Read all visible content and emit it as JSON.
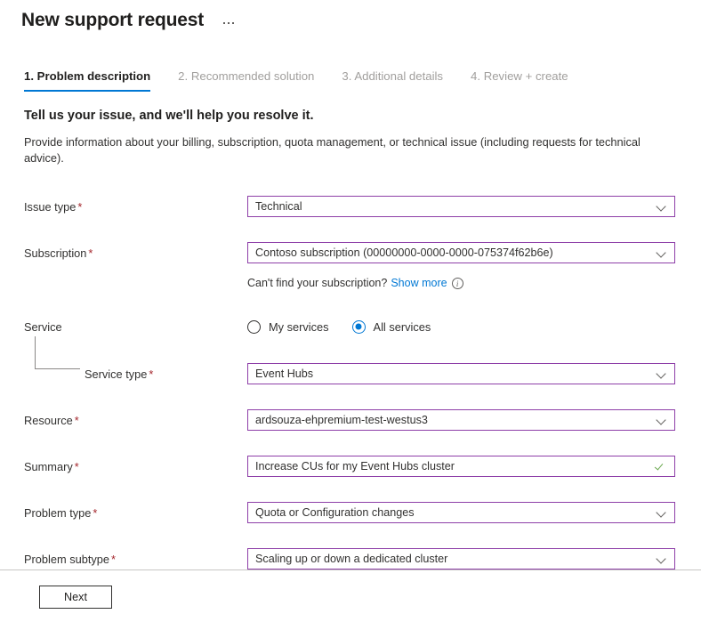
{
  "header": {
    "title": "New support request",
    "more_menu": "ellipsis-menu"
  },
  "tabs": [
    {
      "label": "1. Problem description",
      "active": true
    },
    {
      "label": "2. Recommended solution",
      "active": false
    },
    {
      "label": "3. Additional details",
      "active": false
    },
    {
      "label": "4. Review + create",
      "active": false
    }
  ],
  "intro": {
    "heading": "Tell us your issue, and we'll help you resolve it.",
    "text": "Provide information about your billing, subscription, quota management, or technical issue (including requests for technical advice)."
  },
  "form": {
    "issue_type": {
      "label": "Issue type",
      "required": "*",
      "value": "Technical"
    },
    "subscription": {
      "label": "Subscription",
      "required": "*",
      "value": "Contoso subscription (00000000-0000-0000-075374f62b6e)"
    },
    "subscription_helper": {
      "text": "Can't find your subscription?",
      "link": "Show more",
      "info": "i"
    },
    "service": {
      "label": "Service",
      "options": [
        {
          "label": "My services",
          "selected": false
        },
        {
          "label": "All services",
          "selected": true
        }
      ]
    },
    "service_type": {
      "label": "Service type",
      "required": "*",
      "value": "Event Hubs"
    },
    "resource": {
      "label": "Resource",
      "required": "*",
      "value": "ardsouza-ehpremium-test-westus3"
    },
    "summary": {
      "label": "Summary",
      "required": "*",
      "value": "Increase CUs for my Event Hubs cluster"
    },
    "problem_type": {
      "label": "Problem type",
      "required": "*",
      "value": "Quota or Configuration changes"
    },
    "problem_subtype": {
      "label": "Problem subtype",
      "required": "*",
      "value": "Scaling up or down a dedicated cluster"
    }
  },
  "footer": {
    "next_label": "Next"
  },
  "colors": {
    "accent_blue": "#0078d4",
    "field_border": "#8e3fa8",
    "required_red": "#a4262c",
    "valid_green": "#6aa84f",
    "tab_inactive": "#a19f9d"
  }
}
